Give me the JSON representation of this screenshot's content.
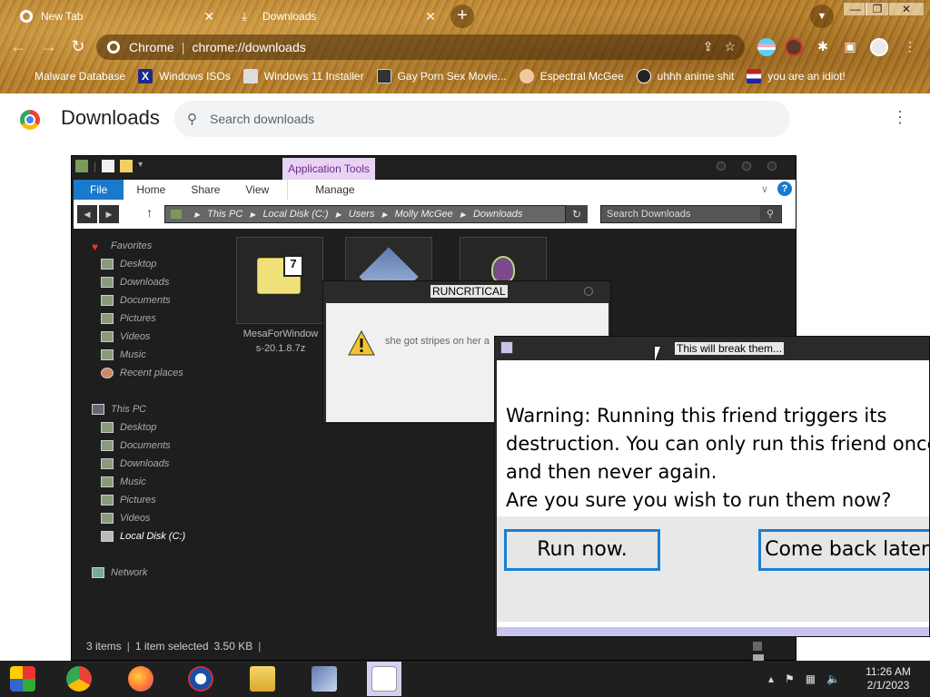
{
  "browser": {
    "tabs": [
      {
        "label": "New Tab",
        "icon": "chrome-icon"
      },
      {
        "label": "Downloads",
        "icon": "download-icon"
      }
    ],
    "omnibox": {
      "site": "Chrome",
      "url": "chrome://downloads"
    },
    "bookmarks": [
      {
        "label": "Malware Database"
      },
      {
        "label": "Windows ISOs"
      },
      {
        "label": "Windows 11 Installer"
      },
      {
        "label": "Gay Porn Sex Movie..."
      },
      {
        "label": "Espectral McGee"
      },
      {
        "label": "uhhh anime shit"
      },
      {
        "label": "you are an idiot!"
      }
    ],
    "theme_color": "#b5822e"
  },
  "downloads_page": {
    "title": "Downloads",
    "search_placeholder": "Search downloads"
  },
  "explorer": {
    "contextual_tab": "Application Tools",
    "ribbon_tabs": [
      "File",
      "Home",
      "Share",
      "View",
      "Manage"
    ],
    "breadcrumb": [
      "This PC",
      "Local Disk (C:)",
      "Users",
      "Molly McGee",
      "Downloads"
    ],
    "search_placeholder": "Search Downloads",
    "nav": {
      "favorites_header": "Favorites",
      "favorites": [
        "Desktop",
        "Downloads",
        "Documents",
        "Pictures",
        "Videos",
        "Music",
        "Recent places"
      ],
      "this_pc_header": "This PC",
      "this_pc": [
        "Desktop",
        "Documents",
        "Downloads",
        "Music",
        "Pictures",
        "Videos",
        "Local Disk (C:)"
      ],
      "network": "Network"
    },
    "files": [
      {
        "name_line1": "MesaForWindow",
        "name_line2": "s-20.1.8.7z"
      }
    ],
    "status": {
      "items": "3 items",
      "selected": "1 item selected",
      "size": "3.50 KB"
    }
  },
  "dialog_runcritical": {
    "title": "RUNCRITICAL",
    "message": "she got stripes on her a"
  },
  "dialog_friend": {
    "title": "This will break them...",
    "lines": [
      "Warning: Running this friend triggers its",
      "destruction. You can only run this friend once,",
      "and then never again.",
      "Are you sure you wish to run them now?"
    ],
    "run_label": "Run now.",
    "later_label": "Come back later."
  },
  "taskbar": {
    "time": "11:26 AM",
    "date": "2/1/2023"
  }
}
